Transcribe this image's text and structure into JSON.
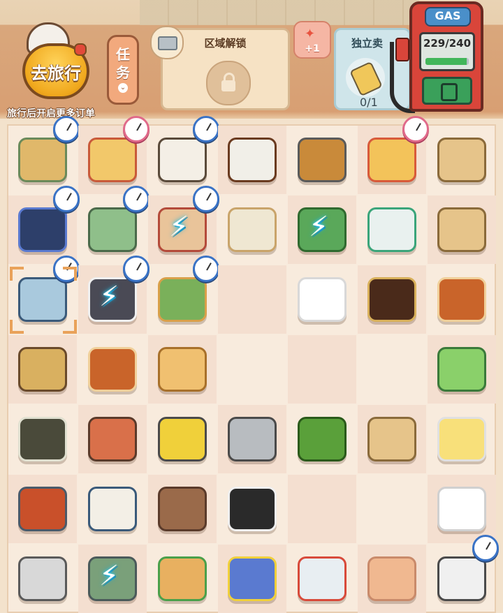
{
  "travel": {
    "label": "去旅行",
    "note": "旅行后开启更多订单"
  },
  "task": {
    "label1": "任",
    "label2": "务",
    "chevron": "⌄"
  },
  "area_unlock": {
    "title": "区域解锁"
  },
  "reward": {
    "label": "+1"
  },
  "independent": {
    "title": "独立卖",
    "count": "0/1"
  },
  "gas": {
    "label": "GAS",
    "value": "229/240",
    "current": 229,
    "max": 240
  },
  "board": {
    "cols": 7,
    "rows": 7,
    "items": [
      [
        "hand-truck",
        "bakery-box",
        "tray-of-bottles",
        "coffee-bean-sack",
        "brush",
        "folding-fan",
        "paper-bag"
      ],
      [
        "food-stand-cloth",
        "rice-cooker",
        "vendor-cart",
        "rice-tray",
        "green-plant",
        "glue-bottle",
        "paper-bag"
      ],
      [
        "ice-cabinet",
        "drain-pipes",
        "scooter-delivery",
        "",
        "chef-hat",
        "soy-sauce-bottle",
        "sauce-bottle"
      ],
      [
        "hammer",
        "sauce-bottle",
        "bread-bun",
        "",
        "",
        "",
        "gum-pack"
      ],
      [
        "sugar-cane",
        "meat-skewers",
        "pliers",
        "screw",
        "green-ball",
        "paper-bag",
        "butter-pack"
      ],
      [
        "meat-stew",
        "noodle-bowl",
        "rope",
        "sushi-roll",
        "",
        "",
        "sugar-cubes"
      ],
      [
        "pot-lid",
        "fried-dish",
        "egg-toast",
        "poster",
        "bottles",
        "paper-sheet",
        "printer"
      ]
    ]
  },
  "colors": {
    "accent": "#f0a81d",
    "gas_red": "#d9453a",
    "timer_blue": "#3a73c6",
    "bolt": "#39d3f0"
  }
}
